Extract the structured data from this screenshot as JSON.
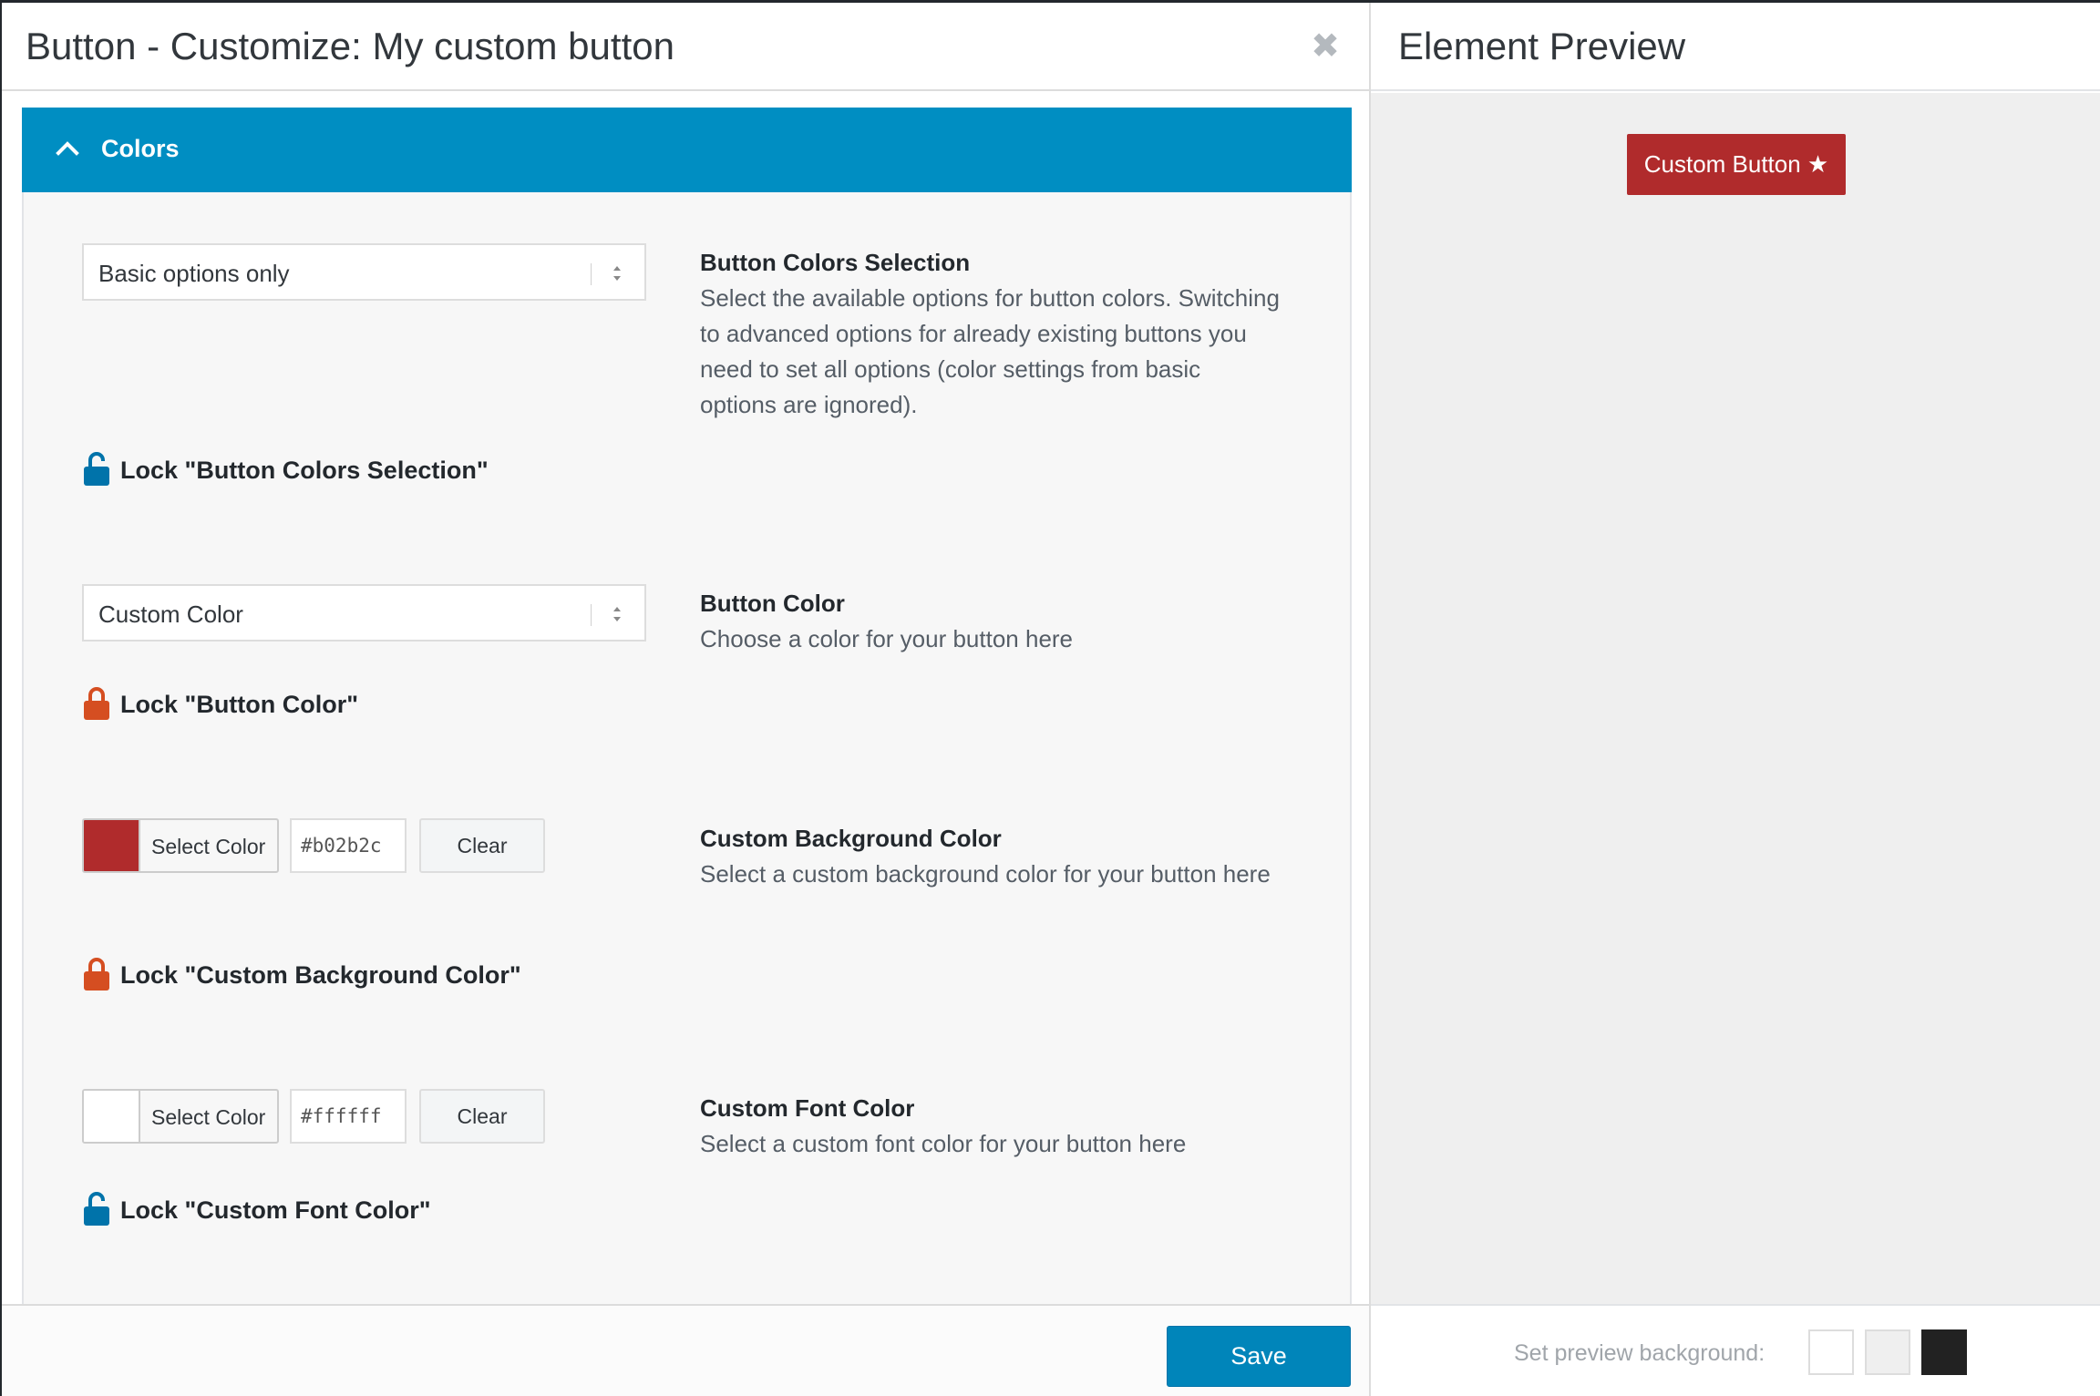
{
  "editor": {
    "title": "Button - Customize: My custom button",
    "close_icon": "close-icon",
    "section": {
      "title": "Colors",
      "icon": "chevron-up-icon",
      "color": "#008ec2"
    },
    "options": {
      "colors_selection": {
        "select_value": "Basic options only",
        "title": "Button Colors Selection",
        "description": "Select the available options for button colors. Switching to advanced options for already existing buttons you need to set all options (color settings from basic options are ignored).",
        "lock_label": "Lock \"Button Colors Selection\"",
        "locked": false,
        "lock_color": "#0073aa"
      },
      "button_color": {
        "select_value": "Custom Color",
        "title": "Button Color",
        "description": "Choose a color for your button here",
        "lock_label": "Lock \"Button Color\"",
        "locked": true,
        "lock_color": "#d54e21"
      },
      "custom_background": {
        "swatch_color": "#b02b2c",
        "select_label": "Select Color",
        "hex_value": "#b02b2c",
        "clear_label": "Clear",
        "title": "Custom Background Color",
        "description": "Select a custom background color for your button here",
        "lock_label": "Lock \"Custom Background Color\"",
        "locked": true,
        "lock_color": "#d54e21"
      },
      "custom_font": {
        "swatch_color": "#ffffff",
        "select_label": "Select Color",
        "hex_value": "#ffffff",
        "clear_label": "Clear",
        "title": "Custom Font Color",
        "description": "Select a custom font color for your button here",
        "lock_label": "Lock \"Custom Font Color\"",
        "locked": false,
        "lock_color": "#0073aa"
      }
    },
    "footer": {
      "save_label": "Save"
    }
  },
  "preview": {
    "title": "Element Preview",
    "button": {
      "label": "Custom Button ★",
      "background": "#b02b2c",
      "text_color": "#ffffff"
    },
    "footer": {
      "label": "Set preview background:",
      "swatches": [
        "#ffffff",
        "#efefef",
        "#222222"
      ]
    }
  }
}
